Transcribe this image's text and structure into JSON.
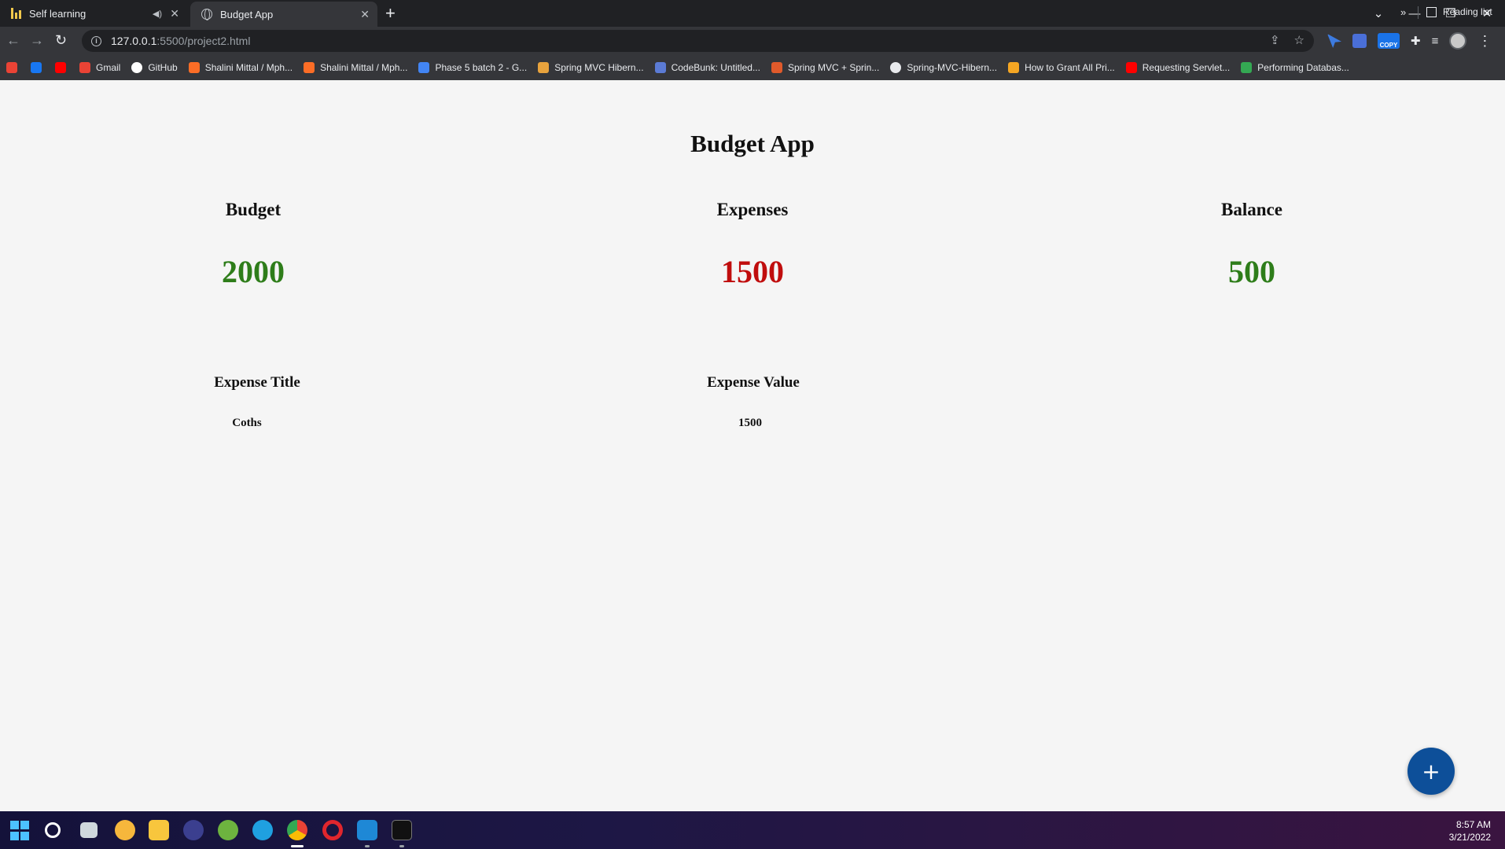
{
  "browser": {
    "tabs": [
      {
        "title": "Self learning",
        "active": false,
        "audio": true
      },
      {
        "title": "Budget App",
        "active": true
      }
    ],
    "url": {
      "host": "127.0.0.1",
      "path": ":5500/project2.html"
    },
    "bookmarks": [
      {
        "label": "",
        "icon": "gmail-icon",
        "color": "#ea4335"
      },
      {
        "label": "",
        "icon": "facebook-icon",
        "color": "#1877f2"
      },
      {
        "label": "",
        "icon": "youtube-icon",
        "color": "#ff0000"
      },
      {
        "label": "Gmail",
        "icon": "gmail-icon",
        "color": "#ea4335"
      },
      {
        "label": "GitHub",
        "icon": "github-icon",
        "color": "#ffffff"
      },
      {
        "label": "Shalini Mittal / Mph...",
        "icon": "gitlab-icon",
        "color": "#fc6d26"
      },
      {
        "label": "Shalini Mittal / Mph...",
        "icon": "gitlab-icon",
        "color": "#fc6d26"
      },
      {
        "label": "Phase 5 batch 2 - G...",
        "icon": "docs-icon",
        "color": "#4285f4"
      },
      {
        "label": "Spring MVC Hibern...",
        "icon": "javatpoint-icon",
        "color": "#e8a33d"
      },
      {
        "label": "CodeBunk: Untitled...",
        "icon": "codebunk-icon",
        "color": "#5b7bd5"
      },
      {
        "label": "Spring MVC + Sprin...",
        "icon": "journaldev-icon",
        "color": "#e05a2b"
      },
      {
        "label": "Spring-MVC-Hibern...",
        "icon": "globe-icon",
        "color": "#e8eaed"
      },
      {
        "label": "How to Grant All Pri...",
        "icon": "digitalocean-icon",
        "color": "#f5a623"
      },
      {
        "label": "Requesting Servlet...",
        "icon": "youtube-icon",
        "color": "#ff0000"
      },
      {
        "label": "Performing Databas...",
        "icon": "site-icon",
        "color": "#34a853"
      }
    ],
    "more_bookmarks": "»",
    "reading_list": "Reading list"
  },
  "app": {
    "title": "Budget App",
    "summary": {
      "budget_label": "Budget",
      "budget_value": "2000",
      "expenses_label": "Expenses",
      "expenses_value": "1500",
      "balance_label": "Balance",
      "balance_value": "500"
    },
    "table": {
      "headers": [
        "Expense Title",
        "Expense Value"
      ],
      "rows": [
        {
          "title": "Coths",
          "value": "1500"
        }
      ]
    },
    "add_button": "+"
  },
  "colors": {
    "positive": "#2e7d1a",
    "negative": "#c00d0d",
    "fab": "#0d4f99"
  },
  "taskbar": {
    "time": "8:57 AM",
    "date": "3/21/2022"
  }
}
